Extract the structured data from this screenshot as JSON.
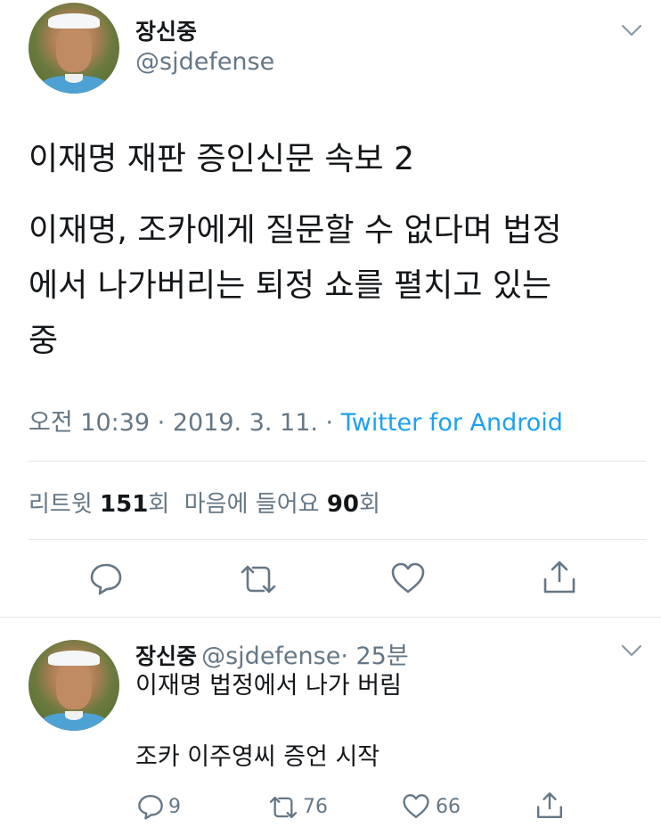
{
  "tweet": {
    "author_name": "장신중",
    "author_handle": "@sjdefense",
    "line1": "이재명 재판 증인신문 속보 2",
    "line2": "이재명, 조카에게 질문할 수 없다며 법정",
    "line3": "에서 나가버리는 퇴정 쇼를 펼치고 있는",
    "line4": "중",
    "time": "오전 10:39 · 2019. 3. 11. · ",
    "source": "Twitter for Android",
    "retweets_label": "리트윗",
    "retweets_count": "151",
    "retweets_unit": "회",
    "likes_label": "마음에 들어요",
    "likes_count": "90",
    "likes_unit": "회"
  },
  "reply": {
    "author_name": "장신중",
    "author_handle": "@sjdefense",
    "age": "· 25분",
    "line1": "이재명 법정에서 나가 버림",
    "line2": "조카 이주영씨 증언 시작",
    "reply_count": "9",
    "retweet_count": "76",
    "like_count": "66"
  },
  "icons": {
    "caret": "chevron-down-icon",
    "reply": "reply-icon",
    "retweet": "retweet-icon",
    "like": "heart-icon",
    "share": "share-icon"
  },
  "colors": {
    "link": "#1da1f2",
    "muted": "#657786",
    "divider": "#e1e8ed"
  }
}
